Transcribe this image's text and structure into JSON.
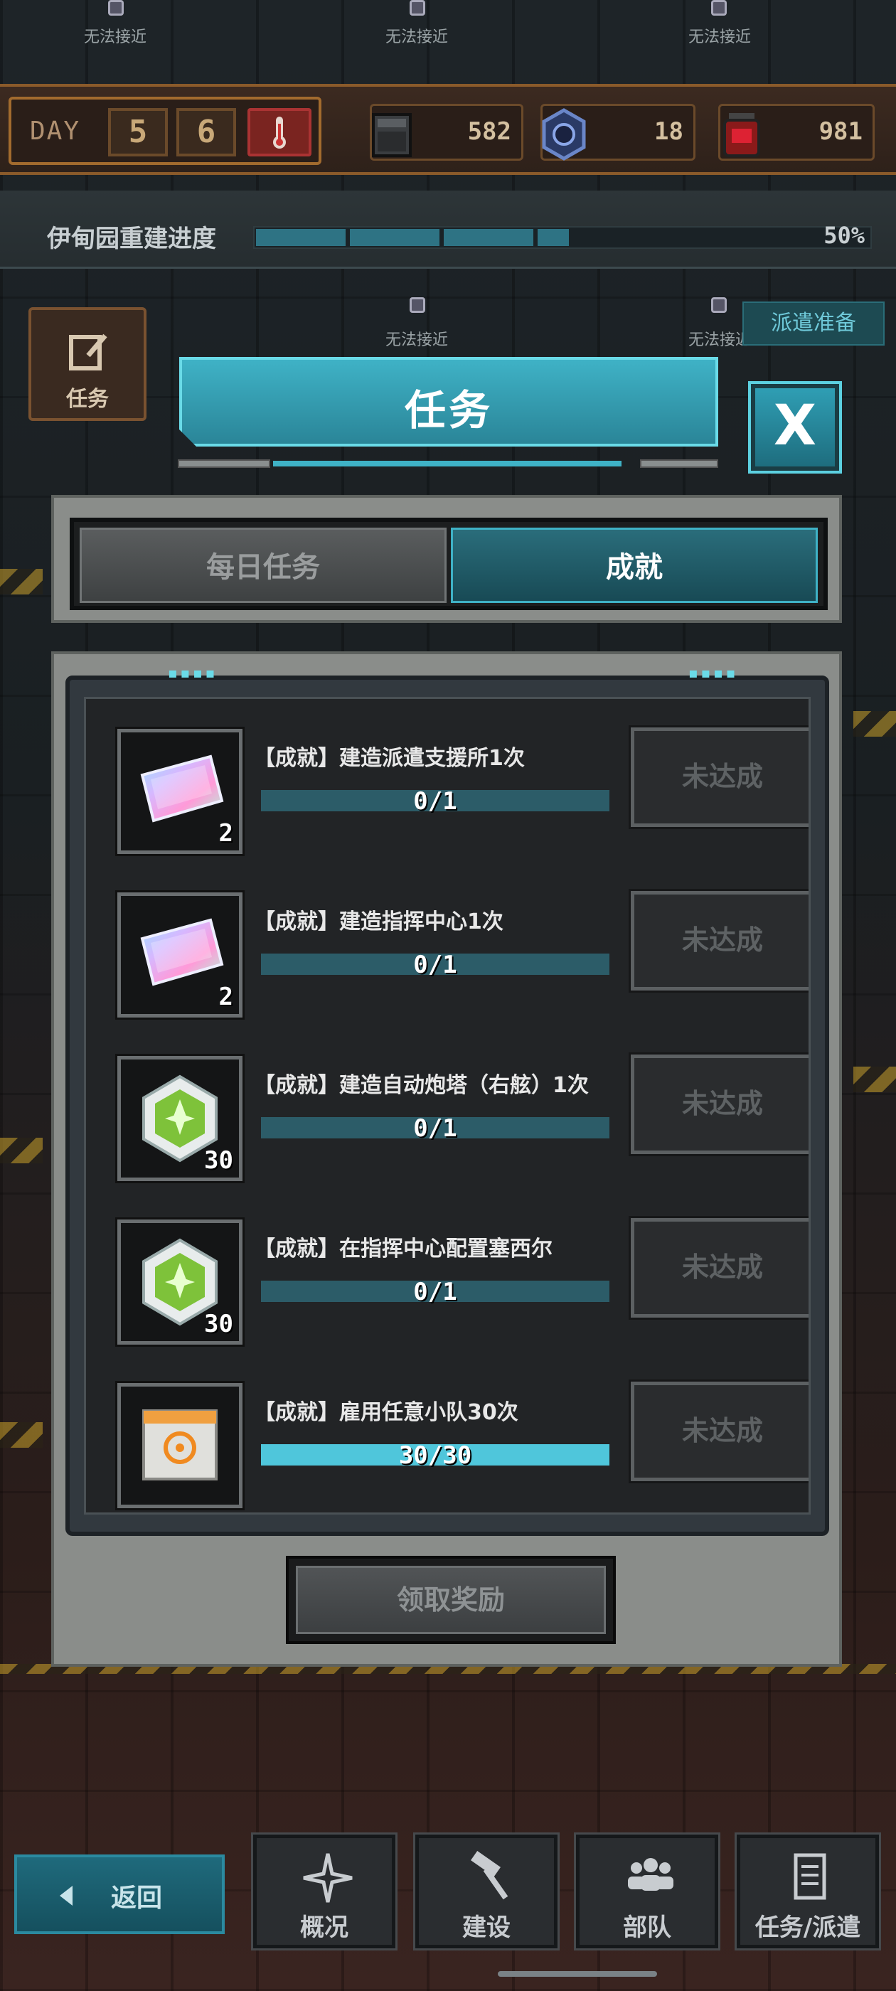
{
  "background": {
    "locked_labels": [
      "无法接近",
      "无法接近",
      "无法接近",
      "无法接近",
      "无法接近"
    ]
  },
  "topbar": {
    "day_label": "DAY",
    "day_digits": [
      "5",
      "6"
    ],
    "resources": [
      {
        "icon": "ore-block-icon",
        "value": "582"
      },
      {
        "icon": "gear-part-icon",
        "value": "18"
      },
      {
        "icon": "red-canister-icon",
        "value": "981"
      }
    ]
  },
  "rebuild": {
    "label": "伊甸园重建进度",
    "percent": "50%",
    "progress": 0.5
  },
  "sidebar": {
    "task_label": "任务",
    "dispatch_tag": "派遣准备"
  },
  "modal": {
    "title": "任务",
    "close_label": "X",
    "tabs": [
      {
        "label": "每日任务",
        "active": false
      },
      {
        "label": "成就",
        "active": true
      }
    ],
    "items": [
      {
        "title": "【成就】建造派遣支援所1次",
        "progress_text": "0/1",
        "progress": 0,
        "qty": "2",
        "icon": "holo-ticket-icon",
        "button": "未达成"
      },
      {
        "title": "【成就】建造指挥中心1次",
        "progress_text": "0/1",
        "progress": 0,
        "qty": "2",
        "icon": "holo-ticket-icon",
        "button": "未达成"
      },
      {
        "title": "【成就】建造自动炮塔（右舷）1次",
        "progress_text": "0/1",
        "progress": 0,
        "qty": "30",
        "icon": "green-gem-icon",
        "button": "未达成"
      },
      {
        "title": "【成就】在指挥中心配置塞西尔",
        "progress_text": "0/1",
        "progress": 0,
        "qty": "30",
        "icon": "green-gem-icon",
        "button": "未达成"
      },
      {
        "title": "【成就】雇用任意小队30次",
        "progress_text": "30/30",
        "progress": 1,
        "qty": "",
        "icon": "supply-crate-icon",
        "button": "未达成"
      }
    ],
    "claim_label": "领取奖励"
  },
  "bottom_nav": {
    "back_label": "返回",
    "items": [
      {
        "label": "概况",
        "icon": "compass-star-icon"
      },
      {
        "label": "建设",
        "icon": "hammer-icon"
      },
      {
        "label": "部队",
        "icon": "people-icon"
      },
      {
        "label": "任务/派遣",
        "icon": "clipboard-icon"
      }
    ]
  },
  "colors": {
    "accent": "#3fb2c6",
    "progress_track": "#2c5c68",
    "disabled_text": "#5e6264"
  }
}
